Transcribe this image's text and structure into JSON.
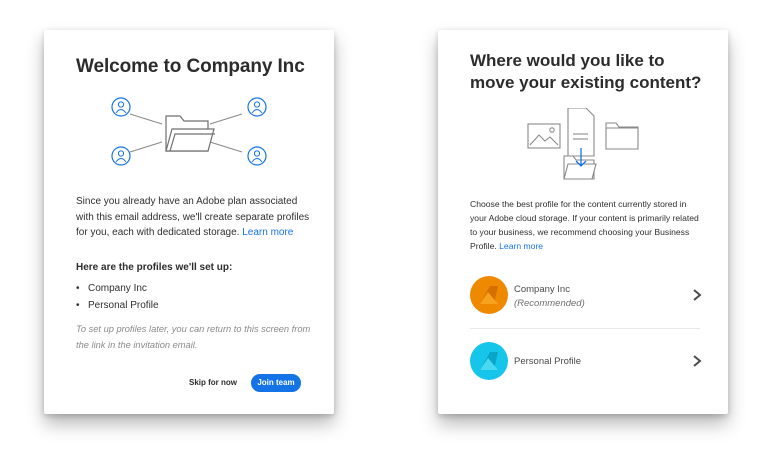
{
  "left": {
    "title": "Welcome to Company Inc",
    "description": "Since you already have an Adobe plan associated with this email address, we'll create separate profiles for you, each with dedicated storage.",
    "learn_more": "Learn more",
    "profiles_heading": "Here are the profiles we'll set up:",
    "profiles": [
      "Company Inc",
      "Personal Profile"
    ],
    "bullet": "•",
    "note": "To set up profiles later, you can return to this screen from the link in the invitation email.",
    "skip_label": "Skip for now",
    "join_label": "Join team",
    "illustration": "folder-with-user-icons"
  },
  "right": {
    "title": "Where would you like to move your existing content?",
    "description": "Choose the best profile for the content currently stored in your Adobe cloud storage. If your content is primarily related to your business, we recommend choosing your Business Profile.",
    "learn_more": "Learn more",
    "illustration": "files-move-to-folder",
    "options": [
      {
        "name": "Company Inc",
        "sub": "(Recommended)",
        "color": "#ef8a00",
        "icon": "chevron-right-icon"
      },
      {
        "name": "Personal Profile",
        "color": "#16c5ea",
        "icon": "chevron-right-icon"
      }
    ]
  },
  "colors": {
    "accent": "#1473e6",
    "icon_stroke": "#8a8a8a"
  }
}
